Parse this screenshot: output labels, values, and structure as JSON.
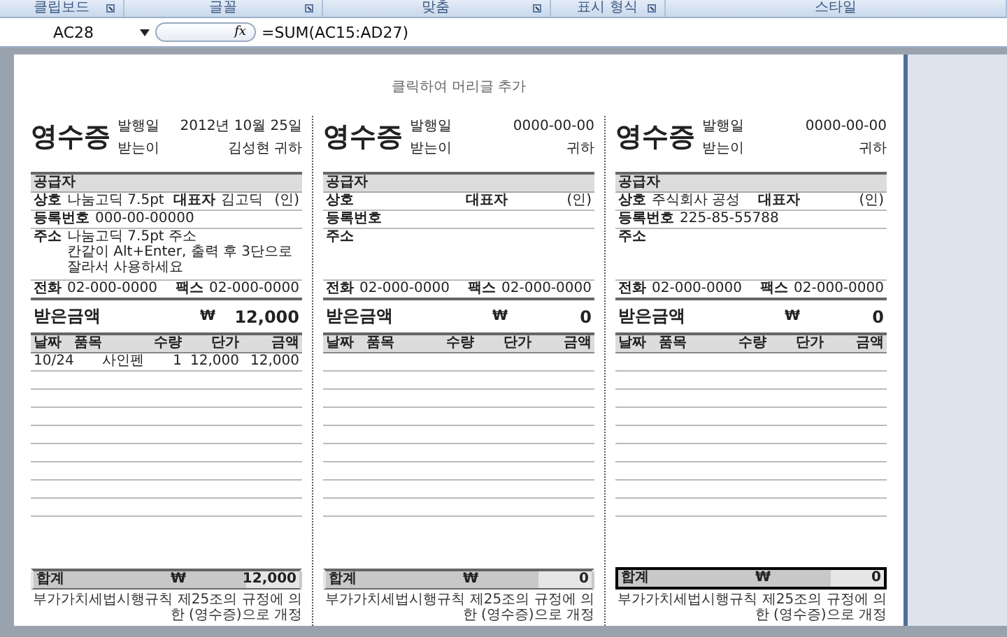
{
  "ribbon": {
    "groups": [
      {
        "label": "클립보드",
        "launcher": true
      },
      {
        "label": "글꼴",
        "launcher": true
      },
      {
        "label": "맞춤",
        "launcher": true
      },
      {
        "label": "표시 형식",
        "launcher": true
      },
      {
        "label": "스타일",
        "launcher": false
      }
    ]
  },
  "formula_bar": {
    "name_box": "AC28",
    "fx": "fx",
    "formula": "=SUM(AC15:AD27)"
  },
  "page": {
    "header_placeholder": "클릭하여 머리글 추가"
  },
  "receipts": [
    {
      "title": "영수증",
      "issue_label": "발행일",
      "issue_date": "2012년 10월 25일",
      "recipient_label": "받는이",
      "recipient": "김성현",
      "honorific": "귀하",
      "supplier": {
        "header": "공급자",
        "name_label": "상호",
        "name": "나눔고딕 7.5pt",
        "rep_label": "대표자",
        "rep": "김고딕",
        "seal": "(인)",
        "reg_label": "등록번호",
        "reg": "000-00-00000",
        "addr_label": "주소",
        "addr": [
          "나눔고딕 7.5pt 주소",
          "칸같이 Alt+Enter, 출력 후 3단으로 잘라서 사용하세요"
        ],
        "tel_label": "전화",
        "tel": "02-000-0000",
        "fax_label": "팩스",
        "fax": "02-000-0000"
      },
      "amount_label": "받은금액",
      "currency": "₩",
      "amount": "12,000",
      "columns": [
        "날짜",
        "품목",
        "수량",
        "단가",
        "금액"
      ],
      "items": [
        [
          "10/24",
          "사인펜",
          "1",
          "12,000",
          "12,000"
        ]
      ],
      "total": {
        "label": "합계",
        "currency": "₩",
        "value": "12,000",
        "selected": false
      },
      "footnote": "부가가치세법시행규칙 제25조의 규정에 의한 (영수증)으로 개정"
    },
    {
      "title": "영수증",
      "issue_label": "발행일",
      "issue_date": "0000-00-00",
      "recipient_label": "받는이",
      "honorific": "귀하",
      "supplier": {
        "header": "공급자",
        "name_label": "상호",
        "rep_label": "대표자",
        "seal": "(인)",
        "reg_label": "등록번호",
        "addr_label": "주소",
        "tel_label": "전화",
        "tel": "02-000-0000",
        "fax_label": "팩스",
        "fax": "02-000-0000"
      },
      "amount_label": "받은금액",
      "currency": "₩",
      "amount": "0",
      "columns": [
        "날짜",
        "품목",
        "수량",
        "단가",
        "금액"
      ],
      "total": {
        "label": "합계",
        "currency": "₩",
        "value": "0",
        "selected": false
      },
      "footnote": "부가가치세법시행규칙 제25조의 규정에 의한 (영수증)으로 개정"
    },
    {
      "title": "영수증",
      "issue_label": "발행일",
      "issue_date": "0000-00-00",
      "recipient_label": "받는이",
      "honorific": "귀하",
      "supplier": {
        "header": "공급자",
        "name_label": "상호",
        "name": "주식회사 공성",
        "rep_label": "대표자",
        "seal": "(인)",
        "reg_label": "등록번호",
        "reg": "225-85-55788",
        "addr_label": "주소",
        "tel_label": "전화",
        "tel": "02-000-0000",
        "fax_label": "팩스",
        "fax": "02-000-0000"
      },
      "amount_label": "받은금액",
      "currency": "₩",
      "amount": "0",
      "columns": [
        "날짜",
        "품목",
        "수량",
        "단가",
        "금액"
      ],
      "total": {
        "label": "합계",
        "currency": "₩",
        "value": "0",
        "selected": true
      },
      "footnote": "부가가치세법시행규칙 제25조의 규정에 의한 (영수증)으로 개정"
    }
  ]
}
